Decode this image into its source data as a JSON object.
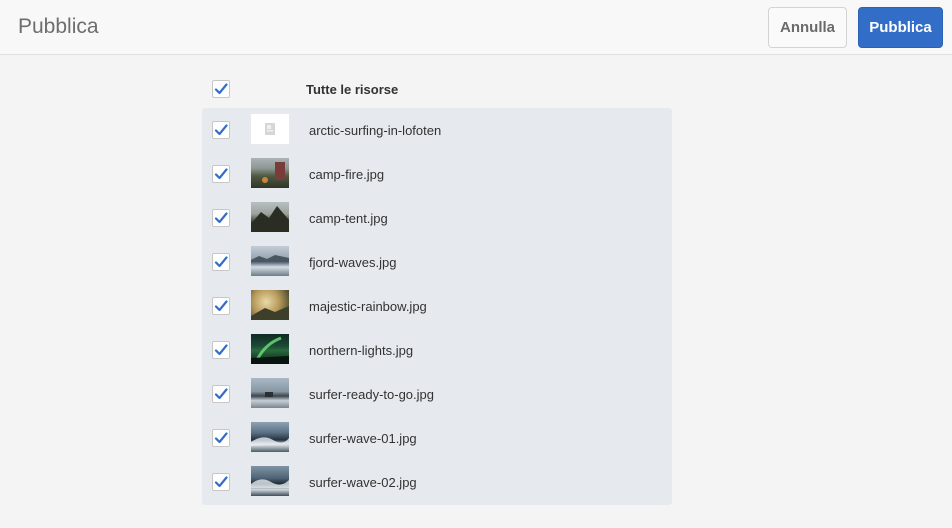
{
  "header": {
    "title": "Pubblica",
    "cancel_label": "Annulla",
    "publish_label": "Pubblica"
  },
  "select_all": {
    "label": "Tutte le risorse",
    "checked": true
  },
  "colors": {
    "accent": "#326ec8",
    "list_background": "#e6eaef"
  },
  "assets": [
    {
      "name": "arctic-surfing-in-lofoten",
      "checked": true,
      "thumbnail": "folder-placeholder"
    },
    {
      "name": "camp-fire.jpg",
      "checked": true,
      "thumbnail": "photo-campfire"
    },
    {
      "name": "camp-tent.jpg",
      "checked": true,
      "thumbnail": "photo-mountain-tent"
    },
    {
      "name": "fjord-waves.jpg",
      "checked": true,
      "thumbnail": "photo-fjord"
    },
    {
      "name": "majestic-rainbow.jpg",
      "checked": true,
      "thumbnail": "photo-rainbow"
    },
    {
      "name": "northern-lights.jpg",
      "checked": true,
      "thumbnail": "photo-aurora"
    },
    {
      "name": "surfer-ready-to-go.jpg",
      "checked": true,
      "thumbnail": "photo-surfer-beach"
    },
    {
      "name": "surfer-wave-01.jpg",
      "checked": true,
      "thumbnail": "photo-wave"
    },
    {
      "name": "surfer-wave-02.jpg",
      "checked": true,
      "thumbnail": "photo-wave"
    }
  ]
}
